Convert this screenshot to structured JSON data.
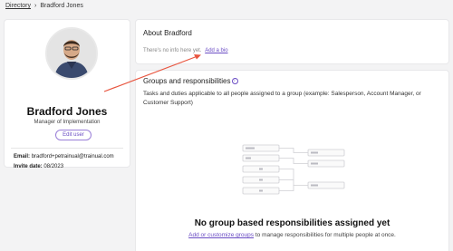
{
  "breadcrumb": {
    "parent": "Directory",
    "separator": "›",
    "current": "Bradford Jones"
  },
  "profile": {
    "name": "Bradford Jones",
    "role": "Manager of Implementation",
    "edit_label": "Edit user",
    "email_label": "Email:",
    "email_value": "bradford+petrainual@trainual.com",
    "invite_label": "Invite date:",
    "invite_value": "08/2023"
  },
  "about": {
    "title": "About Bradford",
    "empty_text": "There's no info here yet.",
    "add_bio_link": "Add a bio"
  },
  "groups": {
    "title": "Groups and responsibilities",
    "info_icon": "i",
    "description": "Tasks and duties applicable to all people assigned to a group (example: Salesperson, Account Manager, or Customer Support)",
    "empty_title": "No group based responsibilities assigned yet",
    "empty_link": "Add or customize groups",
    "empty_rest": "to manage responsibilities for multiple people at once."
  },
  "colors": {
    "accent": "#6a4cc4",
    "annotation_arrow": "#e8553f"
  }
}
